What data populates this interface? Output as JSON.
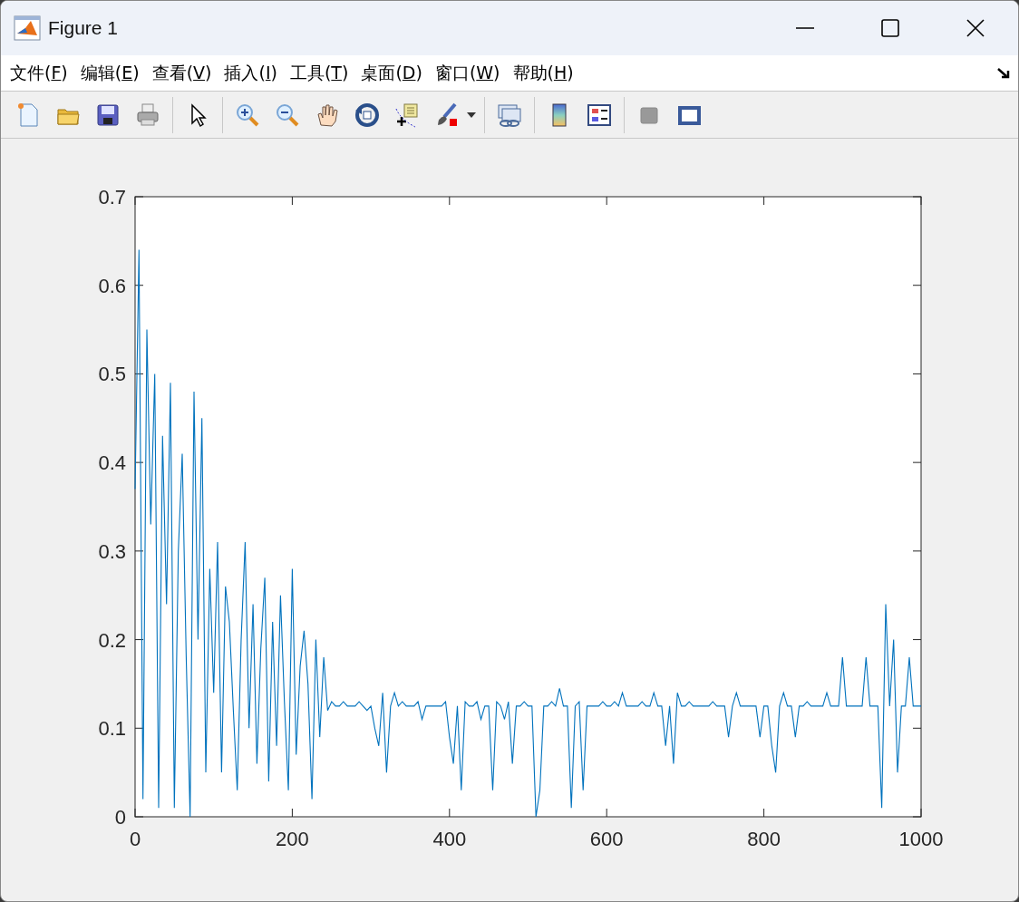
{
  "window": {
    "title": "Figure 1"
  },
  "menu": [
    {
      "before": "文件(",
      "key": "F",
      "after": ")"
    },
    {
      "before": "编辑(",
      "key": "E",
      "after": ")"
    },
    {
      "before": "查看(",
      "key": "V",
      "after": ")"
    },
    {
      "before": "插入(",
      "key": "I",
      "after": ")"
    },
    {
      "before": "工具(",
      "key": "T",
      "after": ")"
    },
    {
      "before": "桌面(",
      "key": "D",
      "after": ")"
    },
    {
      "before": "窗口(",
      "key": "W",
      "after": ")"
    },
    {
      "before": "帮助(",
      "key": "H",
      "after": ")"
    }
  ],
  "chart_data": {
    "type": "line",
    "xlim": [
      0,
      1000
    ],
    "ylim": [
      0,
      0.7
    ],
    "x": [
      0,
      5,
      10,
      15,
      20,
      25,
      30,
      35,
      40,
      45,
      50,
      55,
      60,
      65,
      70,
      75,
      80,
      85,
      90,
      95,
      100,
      105,
      110,
      115,
      120,
      125,
      130,
      135,
      140,
      145,
      150,
      155,
      160,
      165,
      170,
      175,
      180,
      185,
      190,
      195,
      200,
      205,
      210,
      215,
      220,
      225,
      230,
      235,
      240,
      245,
      250,
      255,
      260,
      265,
      270,
      275,
      280,
      285,
      290,
      295,
      300,
      305,
      310,
      315,
      320,
      325,
      330,
      335,
      340,
      345,
      350,
      355,
      360,
      365,
      370,
      375,
      380,
      385,
      390,
      395,
      400,
      405,
      410,
      415,
      420,
      425,
      430,
      435,
      440,
      445,
      450,
      455,
      460,
      465,
      470,
      475,
      480,
      485,
      490,
      495,
      500,
      505,
      510,
      515,
      520,
      525,
      530,
      535,
      540,
      545,
      550,
      555,
      560,
      565,
      570,
      575,
      580,
      585,
      590,
      595,
      600,
      605,
      610,
      615,
      620,
      625,
      630,
      635,
      640,
      645,
      650,
      655,
      660,
      665,
      670,
      675,
      680,
      685,
      690,
      695,
      700,
      705,
      710,
      715,
      720,
      725,
      730,
      735,
      740,
      745,
      750,
      755,
      760,
      765,
      770,
      775,
      780,
      785,
      790,
      795,
      800,
      805,
      810,
      815,
      820,
      825,
      830,
      835,
      840,
      845,
      850,
      855,
      860,
      865,
      870,
      875,
      880,
      885,
      890,
      895,
      900,
      905,
      910,
      915,
      920,
      925,
      930,
      935,
      940,
      945,
      950,
      955,
      960,
      965,
      970,
      975,
      980,
      985,
      990,
      995,
      1000
    ],
    "xticks": [
      0,
      200,
      400,
      600,
      800,
      1000
    ],
    "yticks": [
      0,
      0.1,
      0.2,
      0.3,
      0.4,
      0.5,
      0.6,
      0.7
    ],
    "series": [
      {
        "color": "#0072bd",
        "values": [
          0.37,
          0.64,
          0.02,
          0.55,
          0.33,
          0.5,
          0.01,
          0.43,
          0.24,
          0.49,
          0.01,
          0.3,
          0.41,
          0.18,
          0.0,
          0.48,
          0.2,
          0.45,
          0.05,
          0.28,
          0.14,
          0.31,
          0.05,
          0.26,
          0.22,
          0.12,
          0.03,
          0.2,
          0.31,
          0.1,
          0.24,
          0.06,
          0.19,
          0.27,
          0.04,
          0.22,
          0.08,
          0.25,
          0.13,
          0.03,
          0.28,
          0.07,
          0.17,
          0.21,
          0.15,
          0.02,
          0.2,
          0.09,
          0.18,
          0.12,
          0.13,
          0.125,
          0.125,
          0.13,
          0.125,
          0.125,
          0.125,
          0.13,
          0.125,
          0.12,
          0.125,
          0.1,
          0.08,
          0.14,
          0.05,
          0.125,
          0.14,
          0.125,
          0.13,
          0.125,
          0.125,
          0.125,
          0.13,
          0.11,
          0.125,
          0.125,
          0.125,
          0.125,
          0.125,
          0.13,
          0.09,
          0.06,
          0.125,
          0.03,
          0.13,
          0.125,
          0.125,
          0.13,
          0.11,
          0.125,
          0.125,
          0.03,
          0.13,
          0.125,
          0.11,
          0.13,
          0.06,
          0.125,
          0.125,
          0.13,
          0.125,
          0.125,
          0.0,
          0.03,
          0.125,
          0.125,
          0.13,
          0.125,
          0.145,
          0.125,
          0.125,
          0.01,
          0.125,
          0.13,
          0.03,
          0.125,
          0.125,
          0.125,
          0.125,
          0.13,
          0.125,
          0.125,
          0.13,
          0.125,
          0.14,
          0.125,
          0.125,
          0.125,
          0.125,
          0.13,
          0.125,
          0.125,
          0.14,
          0.125,
          0.125,
          0.08,
          0.125,
          0.06,
          0.14,
          0.125,
          0.125,
          0.13,
          0.125,
          0.125,
          0.125,
          0.125,
          0.125,
          0.13,
          0.125,
          0.125,
          0.125,
          0.09,
          0.125,
          0.14,
          0.125,
          0.125,
          0.125,
          0.125,
          0.125,
          0.09,
          0.125,
          0.125,
          0.08,
          0.05,
          0.125,
          0.14,
          0.125,
          0.125,
          0.09,
          0.125,
          0.125,
          0.13,
          0.125,
          0.125,
          0.125,
          0.125,
          0.14,
          0.125,
          0.125,
          0.125,
          0.18,
          0.125,
          0.125,
          0.125,
          0.125,
          0.125,
          0.18,
          0.125,
          0.125,
          0.125,
          0.01,
          0.24,
          0.125,
          0.2,
          0.05,
          0.125,
          0.125,
          0.18,
          0.125,
          0.125,
          0.125
        ]
      }
    ]
  }
}
